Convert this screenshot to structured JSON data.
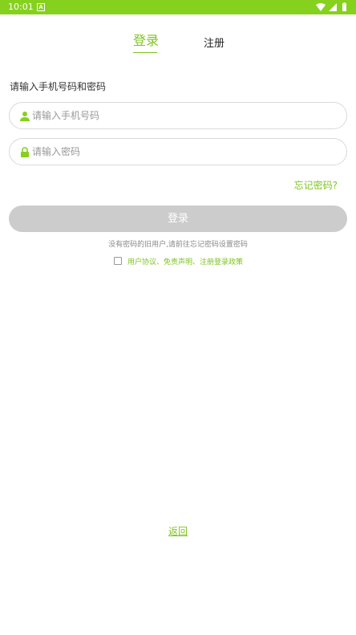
{
  "status_bar": {
    "time": "10:01",
    "notification_badge": "A",
    "icons": [
      "wifi-icon",
      "signal-icon",
      "battery-icon"
    ],
    "bg_color": "#86d11d"
  },
  "tabs": [
    {
      "label": "登录",
      "active": true
    },
    {
      "label": "注册",
      "active": false
    }
  ],
  "form": {
    "section_label": "请输入手机号码和密码",
    "phone": {
      "placeholder": "请输入手机号码",
      "value": "",
      "icon": "user-icon"
    },
    "password": {
      "placeholder": "请输入密码",
      "value": "",
      "icon": "lock-icon"
    },
    "forgot_label": "忘记密码?",
    "login_label": "登录",
    "hint": "没有密码的旧用户,请前往忘记密码设置密码",
    "agreement": {
      "checked": false,
      "label": "用户协议、免责声明、注册登录政策"
    }
  },
  "footer": {
    "back_label": "返回"
  },
  "colors": {
    "accent": "#7ec41f",
    "button_disabled": "#cccccc"
  }
}
